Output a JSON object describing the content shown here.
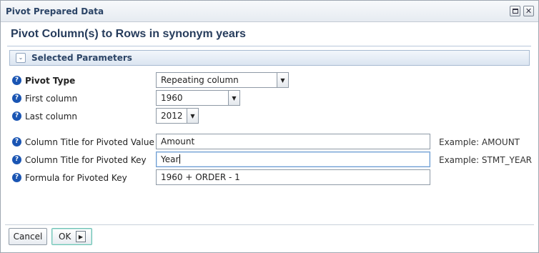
{
  "window": {
    "title": "Pivot Prepared Data",
    "restore_icon": "restore-icon",
    "close_icon": "close-icon",
    "close_glyph": "✕"
  },
  "page_title": "Pivot Column(s) to Rows in synonym years",
  "section": {
    "label": "Selected Parameters",
    "toggle_icon": "collapse-chevron-icon",
    "toggle_glyph": "⌄"
  },
  "help_glyph": "?",
  "fields": {
    "pivot_type": {
      "label": "Pivot Type",
      "value": "Repeating column"
    },
    "first_column": {
      "label": "First column",
      "value": "1960"
    },
    "last_column": {
      "label": "Last column",
      "value": "2012"
    },
    "pivoted_value_title": {
      "label": "Column Title for Pivoted Value",
      "value": "Amount",
      "example": "Example: AMOUNT"
    },
    "pivoted_key_title": {
      "label": "Column Title for Pivoted Key",
      "value": "Year",
      "example": "Example: STMT_YEAR"
    },
    "pivoted_key_formula": {
      "label": "Formula for Pivoted Key",
      "value": "1960 + ORDER - 1"
    }
  },
  "dropdown_glyph": "▼",
  "buttons": {
    "cancel": "Cancel",
    "ok": "OK",
    "ok_arrow_glyph": "▶"
  },
  "colors": {
    "title_text": "#2b4466",
    "help_icon": "#1a55b3",
    "section_border": "#a7bad1",
    "ok_focus": "#6fc2b6"
  }
}
